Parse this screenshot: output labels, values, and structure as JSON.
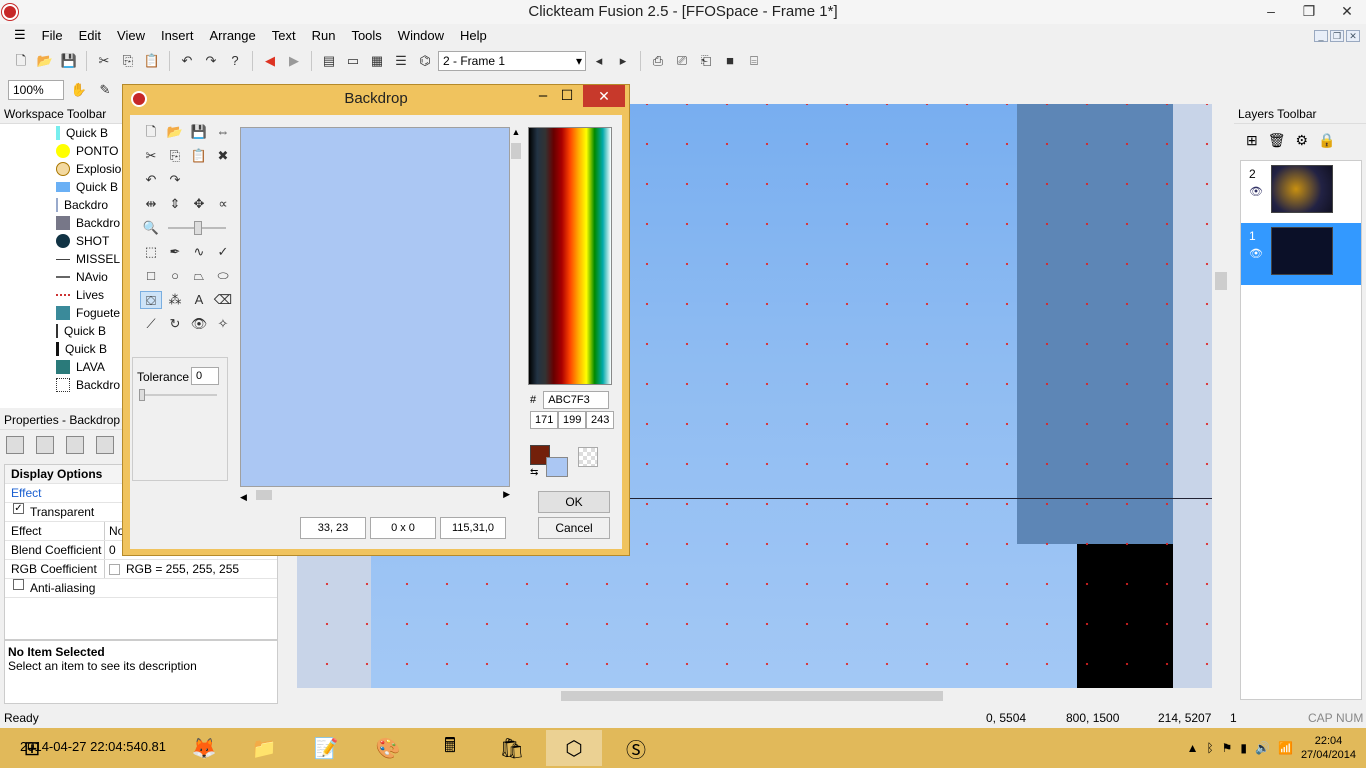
{
  "app": {
    "title": "Clickteam Fusion 2.5 - [FFOSpace - Frame 1*]"
  },
  "window_controls": [
    "–",
    "❐",
    "✕"
  ],
  "menu": [
    "File",
    "Edit",
    "View",
    "Insert",
    "Arrange",
    "Text",
    "Run",
    "Tools",
    "Window",
    "Help"
  ],
  "toolbar": {
    "frame_select": "2 - Frame 1",
    "zoom": "100%"
  },
  "workspace": {
    "title": "Workspace Toolbar",
    "items": [
      {
        "label": "Quick B",
        "icon": "bar-icon"
      },
      {
        "label": "PONTO",
        "icon": "yellow-circle-icon"
      },
      {
        "label": "Explosio",
        "icon": "explosion-icon"
      },
      {
        "label": "Quick B",
        "icon": "blue-rect-icon"
      },
      {
        "label": "Backdro",
        "icon": "backdrop-icon"
      },
      {
        "label": "Backdro",
        "icon": "backdrop-image-icon"
      },
      {
        "label": "SHOT",
        "icon": "shot-icon"
      },
      {
        "label": "MISSEL",
        "icon": "missile-icon"
      },
      {
        "label": "NAvio",
        "icon": "ship-icon"
      },
      {
        "label": "Lives",
        "icon": "lives-icon"
      },
      {
        "label": "Foguete",
        "icon": "rocket-icon"
      },
      {
        "label": "Quick B",
        "icon": "bar-icon"
      },
      {
        "label": "Quick B",
        "icon": "bar-icon"
      },
      {
        "label": "LAVA",
        "icon": "lava-icon"
      },
      {
        "label": "Backdro",
        "icon": "backdrop-icon"
      }
    ]
  },
  "properties": {
    "title": "Properties - Backdrop",
    "section": "Display Options",
    "subsection": "Effect",
    "transparent_label": "Transparent",
    "rows": [
      {
        "key": "Effect",
        "value": "No"
      },
      {
        "key": "Blend Coefficient",
        "value": "0"
      },
      {
        "key": "RGB Coefficient",
        "value": "RGB = 255, 255, 255"
      }
    ],
    "antialiasing_label": "Anti-aliasing",
    "desc_title": "No Item Selected",
    "desc_text": "Select an item to see its description"
  },
  "dialog": {
    "title": "Backdrop",
    "tolerance_label": "Tolerance",
    "tolerance_value": "0",
    "hex_prefix": "#",
    "hex_value": "ABC7F3",
    "rgb": [
      "171",
      "199",
      "243"
    ],
    "coords": "33, 23",
    "size": "0 x 0",
    "color_readout": "115,31,0",
    "ok_label": "OK",
    "cancel_label": "Cancel",
    "fg_color": "#73200a",
    "bg_color": "#abc7f3"
  },
  "layers": {
    "title": "Layers Toolbar",
    "items": [
      {
        "num": "2",
        "selected": false
      },
      {
        "num": "1",
        "selected": true
      }
    ]
  },
  "status": {
    "left": "Ready",
    "pos": "0, 5504",
    "size": "800, 1500",
    "mouse": "214, 5207",
    "layer": "1",
    "cap": "CAP",
    "num": "NUM"
  },
  "taskbar": {
    "overlay_text": "2014-04-27 22:04:540.81",
    "time": "22:04",
    "date": "27/04/2014"
  }
}
